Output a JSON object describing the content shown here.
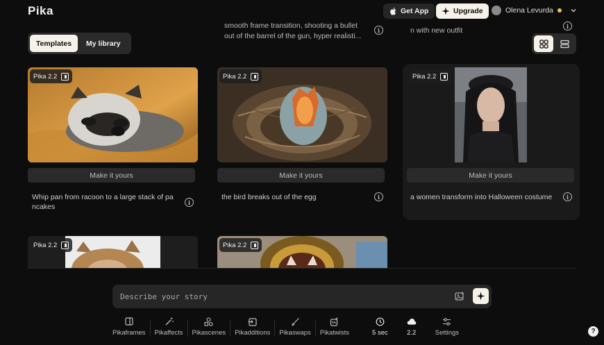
{
  "app": {
    "logo": "Pika"
  },
  "header": {
    "get_app": "Get App",
    "upgrade": "Upgrade",
    "user_name": "Olena Levurda"
  },
  "tabs": [
    {
      "label": "Templates",
      "active": true
    },
    {
      "label": "My library",
      "active": false
    }
  ],
  "top_partial": {
    "col2_line1": "smooth frame transition, shooting a bullet",
    "col2_line2": "out of the barrel of the gun, hyper realisti...",
    "col3_line1": "n with new outfit"
  },
  "cards": [
    {
      "badge": "Pika 2.2",
      "make_label": "Make it yours",
      "desc_line1": "Whip pan from racoon to a large stack of pa",
      "desc_line2": "ncakes"
    },
    {
      "badge": "Pika 2.2",
      "make_label": "Make it yours",
      "desc_line1": "the bird breaks out of the egg",
      "desc_line2": ""
    },
    {
      "badge": "Pika 2.2",
      "make_label": "Make it yours",
      "desc_line1": "a women transform into Halloween costume",
      "desc_line2": ""
    },
    {
      "badge": "Pika 2.2"
    },
    {
      "badge": "Pika 2.2"
    }
  ],
  "prompt": {
    "placeholder": "Describe your story"
  },
  "toolbar": [
    {
      "label": "Pikaframes",
      "icon": "frames-icon"
    },
    {
      "label": "Pikaffects",
      "icon": "magic-wand-icon"
    },
    {
      "label": "Pikascenes",
      "icon": "shapes-icon"
    },
    {
      "label": "Pikadditions",
      "icon": "add-in-frame-icon"
    },
    {
      "label": "Pikaswaps",
      "icon": "brush-icon"
    },
    {
      "label": "Pikatwists",
      "icon": "twist-icon"
    },
    {
      "label": "5 sec",
      "icon": "clock-icon"
    },
    {
      "label": "2.2",
      "icon": "cloud-icon"
    },
    {
      "label": "Settings",
      "icon": "sliders-icon"
    }
  ],
  "help": "?",
  "colors": {
    "accent": "#f6f2e9",
    "status_dot": "#f5c04a",
    "background": "#0d0d0d"
  }
}
